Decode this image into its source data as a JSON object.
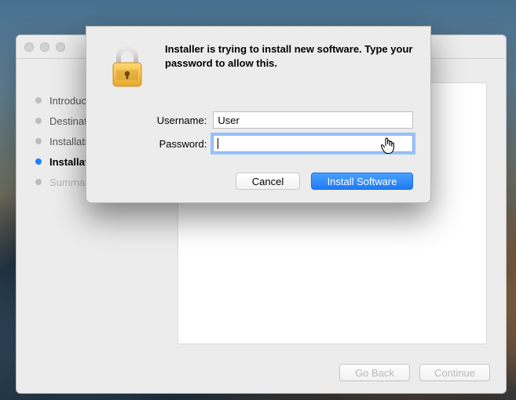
{
  "installer": {
    "sidebar": {
      "steps": [
        {
          "label": "Introduction",
          "state": "done"
        },
        {
          "label": "Destination Select",
          "state": "done"
        },
        {
          "label": "Installation Type",
          "state": "done"
        },
        {
          "label": "Installation",
          "state": "current"
        },
        {
          "label": "Summary",
          "state": "pending"
        }
      ]
    },
    "footer": {
      "go_back": "Go Back",
      "continue": "Continue"
    }
  },
  "auth": {
    "message": "Installer is trying to install new software. Type your password to allow this.",
    "fields": {
      "username": {
        "label": "Username:",
        "value": "User"
      },
      "password": {
        "label": "Password:",
        "value": ""
      }
    },
    "buttons": {
      "cancel": "Cancel",
      "install": "Install Software"
    }
  }
}
